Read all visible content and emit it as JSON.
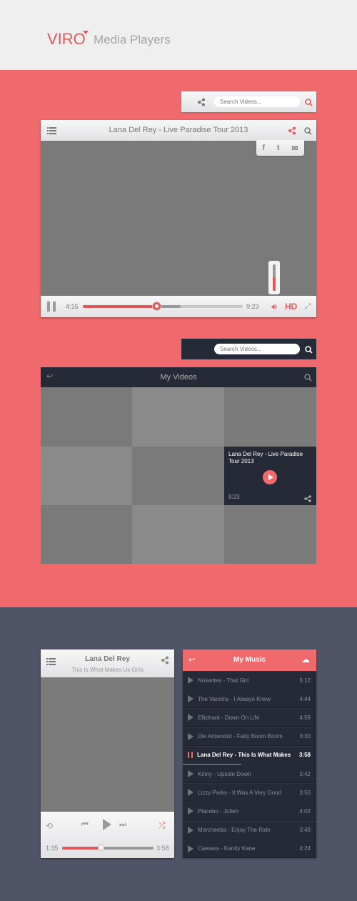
{
  "header": {
    "logo": "VIRO",
    "title": "Media Players"
  },
  "colors": {
    "accent": "#f06a6d",
    "dark": "#262a36",
    "band_dark": "#4f5567",
    "light": "#efeff0"
  },
  "search_light": {
    "placeholder": "Search Videos...",
    "icons": [
      "share-icon",
      "search-icon"
    ]
  },
  "player1": {
    "title": "Lana Del Rey - Live Paradise Tour 2013",
    "current": "4:15",
    "duration": "9:23",
    "progress_percent": 46,
    "buffered_percent": 61,
    "volume_percent": 55,
    "hd": "HD",
    "share_options": [
      "facebook-icon",
      "twitter-icon",
      "mail-icon"
    ]
  },
  "search_dark": {
    "placeholder": "Search Videos..."
  },
  "videos": {
    "title": "My Videos",
    "hover": {
      "title": "Lana Del Rey - Live Paradise Tour 2013",
      "duration": "9:23"
    }
  },
  "player2": {
    "artist": "Lana Del Rey",
    "song": "This Is What Makes Us Girls",
    "current": "1:35",
    "duration": "3:58",
    "progress_percent": 42
  },
  "music": {
    "title": "My Music",
    "tracks": [
      {
        "name": "Noisettes - That Girl",
        "time": "5:12"
      },
      {
        "name": "The Vaccins - I Always Knew",
        "time": "4:44"
      },
      {
        "name": "Elliphant - Down On Life",
        "time": "4:59"
      },
      {
        "name": "Die Antwoord - Fatty Boom Boom",
        "time": "3:30"
      },
      {
        "name": "Lana Del Rey - This Is What Makes",
        "time": "3:58",
        "playing": true
      },
      {
        "name": "Kinny - Upside Down",
        "time": "3:42"
      },
      {
        "name": "Lizzy Parks - It Was A Very Good",
        "time": "3:50"
      },
      {
        "name": "Placebo - Julien",
        "time": "4:02"
      },
      {
        "name": "Morcheeba - Enjoy The Ride",
        "time": "3:49"
      },
      {
        "name": "Caesars - Kandy Kane",
        "time": "4:24"
      }
    ]
  }
}
